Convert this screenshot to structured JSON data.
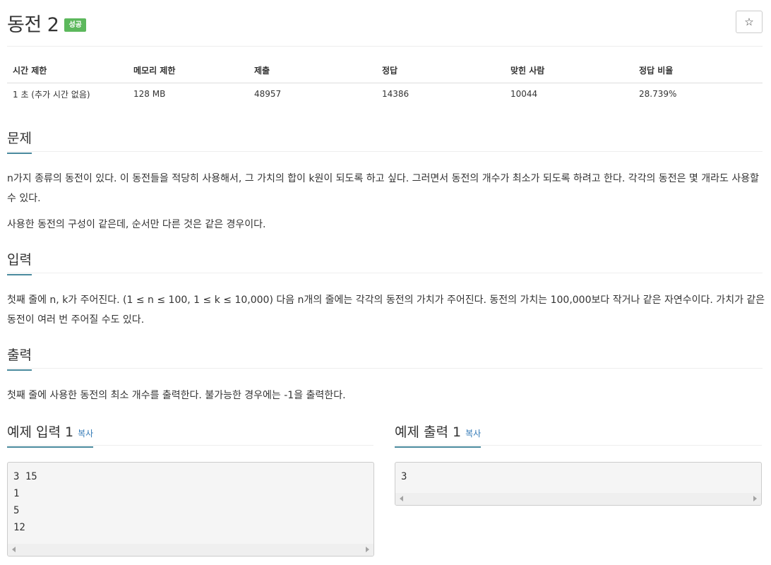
{
  "problem": {
    "title": "동전 2",
    "badge": "성공",
    "star_icon": "☆"
  },
  "stats": {
    "headers": [
      "시간 제한",
      "메모리 제한",
      "제출",
      "정답",
      "맞힌 사람",
      "정답 비율"
    ],
    "values": [
      "1 초 (추가 시간 없음)",
      "128 MB",
      "48957",
      "14386",
      "10044",
      "28.739%"
    ]
  },
  "sections": {
    "problem": {
      "heading": "문제",
      "paragraphs": [
        "n가지 종류의 동전이 있다. 이 동전들을 적당히 사용해서, 그 가치의 합이 k원이 되도록 하고 싶다. 그러면서 동전의 개수가 최소가 되도록 하려고 한다. 각각의 동전은 몇 개라도 사용할 수 있다.",
        "사용한 동전의 구성이 같은데, 순서만 다른 것은 같은 경우이다."
      ]
    },
    "input": {
      "heading": "입력",
      "paragraphs": [
        "첫째 줄에 n, k가 주어진다. (1 ≤ n ≤ 100, 1 ≤ k ≤ 10,000) 다음 n개의 줄에는 각각의 동전의 가치가 주어진다. 동전의 가치는 100,000보다 작거나 같은 자연수이다. 가치가 같은 동전이 여러 번 주어질 수도 있다."
      ]
    },
    "output": {
      "heading": "출력",
      "paragraphs": [
        "첫째 줄에 사용한 동전의 최소 개수를 출력한다. 불가능한 경우에는 -1을 출력한다."
      ]
    }
  },
  "samples": {
    "input": {
      "heading": "예제 입력 1",
      "copy_label": "복사",
      "content": "3 15\n1\n5\n12"
    },
    "output": {
      "heading": "예제 출력 1",
      "copy_label": "복사",
      "content": "3"
    }
  },
  "colors": {
    "badge_bg": "#5cb85c",
    "heading_underline": "#4a8a9e",
    "copy_link": "#337ab7"
  }
}
